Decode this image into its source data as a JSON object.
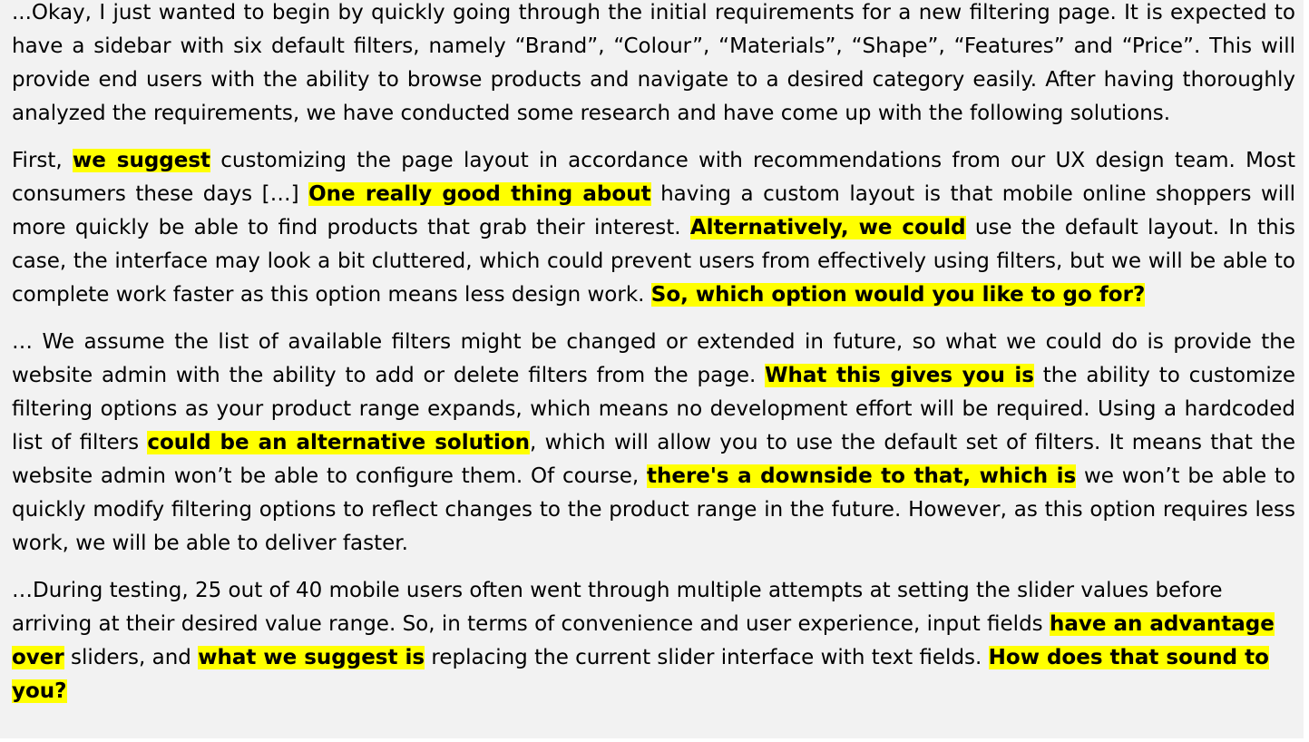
{
  "paragraphs": [
    {
      "id": "intro",
      "segments": [
        {
          "text": "...Okay, I just wanted to begin by quickly going through the initial requirements for a new filtering page.  It is expected to have a sidebar with six default filters, namely “Brand”, “Colour”, “Materials”, “Shape”, “Features” and “Price”. This will provide end users with the ability to browse products and navigate to a desired category easily. After having thoroughly analyzed the requirements, we have conducted some research and have come up with the following solutions.",
          "highlight": false
        }
      ]
    },
    {
      "id": "layout-options",
      "segments": [
        {
          "text": "First, ",
          "highlight": false
        },
        {
          "text": "we suggest",
          "highlight": true
        },
        {
          "text": " customizing the page layout in accordance with recommendations from our UX design team. Most consumers these days […] ",
          "highlight": false
        },
        {
          "text": "One really good thing about",
          "highlight": true
        },
        {
          "text": " having a custom layout is that mobile online shoppers will more quickly be able to find products that grab their interest. ",
          "highlight": false
        },
        {
          "text": "Alternatively, we could",
          "highlight": true
        },
        {
          "text": " use the default layout. In this case, the interface may look a bit cluttered, which could prevent users from effectively using filters, but we will be able to complete work faster as this option means less design work. ",
          "highlight": false
        },
        {
          "text": "So, which option would you like to go for?",
          "highlight": true
        }
      ]
    },
    {
      "id": "filter-admin",
      "segments": [
        {
          "text": "… We assume the list of available filters might be changed or extended in future, so what we could do is provide the website admin with the ability to add or delete filters from the page. ",
          "highlight": false
        },
        {
          "text": "What this gives you is",
          "highlight": true
        },
        {
          "text": " the ability to customize filtering options as your product range expands, which means no development effort will be required. Using a hardcoded list of filters ",
          "highlight": false
        },
        {
          "text": "could be an alternative solution",
          "highlight": true
        },
        {
          "text": ", which will allow you to use the default set of filters. It means that the website admin won’t be able to configure them. Of course, ",
          "highlight": false
        },
        {
          "text": "there's a downside to that, which is",
          "highlight": true
        },
        {
          "text": " we won’t be able to quickly modify filtering options to reflect changes to the product range in the future. However, as this option requires less work, we will be able to deliver faster.",
          "highlight": false
        }
      ]
    },
    {
      "id": "testing",
      "segments": [
        {
          "text": " …During testing, 25 out of 40 mobile users often went through multiple attempts at setting the slider values before arriving at their desired value range. So, in terms of convenience and user experience, input fields ",
          "highlight": false
        },
        {
          "text": "have an advantage over",
          "highlight": true
        },
        {
          "text": " sliders, and ",
          "highlight": false
        },
        {
          "text": "what we suggest is",
          "highlight": true
        },
        {
          "text": " replacing the current slider interface with text fields. ",
          "highlight": false
        },
        {
          "text": "How does that sound to you?",
          "highlight": true
        }
      ]
    }
  ],
  "colors": {
    "background": "#f2f2f2",
    "highlight": "#ffff00",
    "text": "#000000"
  }
}
